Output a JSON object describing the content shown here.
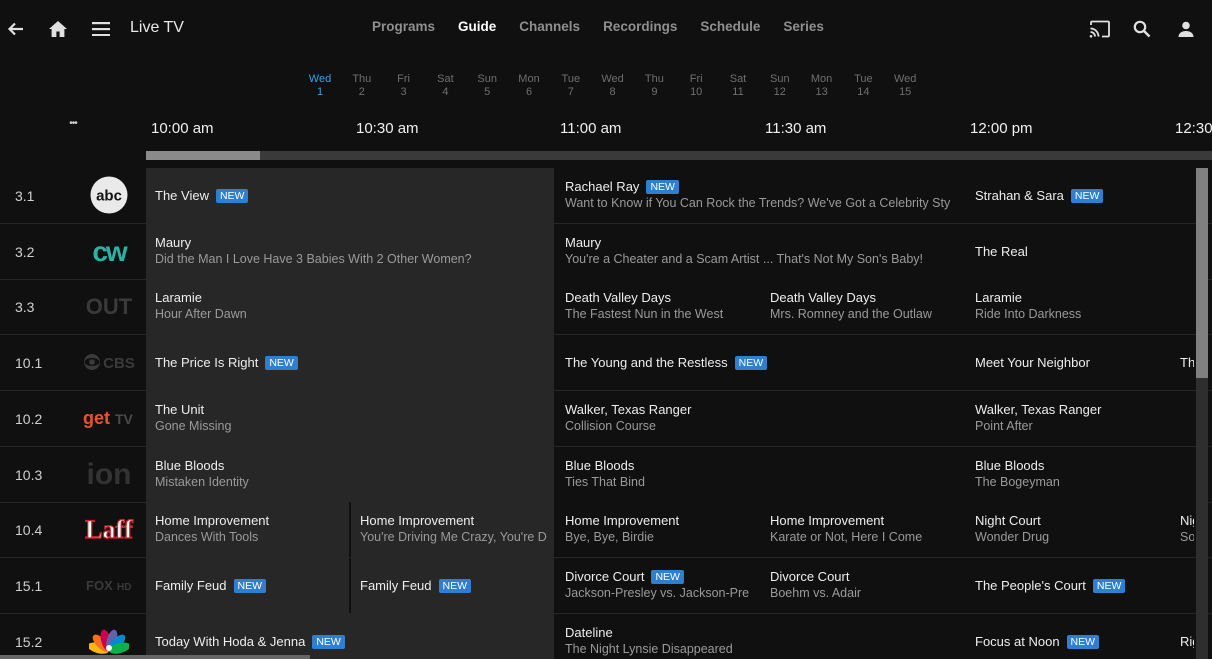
{
  "header": {
    "title": "Live TV",
    "icons": [
      "back-arrow-icon",
      "home-icon",
      "menu-icon",
      "cast-icon",
      "search-icon",
      "user-icon"
    ],
    "tabs": [
      {
        "label": "Programs",
        "active": false
      },
      {
        "label": "Guide",
        "active": true
      },
      {
        "label": "Channels",
        "active": false
      },
      {
        "label": "Recordings",
        "active": false
      },
      {
        "label": "Schedule",
        "active": false
      },
      {
        "label": "Series",
        "active": false
      }
    ]
  },
  "dates": [
    {
      "day": "Wed",
      "num": "1",
      "active": true
    },
    {
      "day": "Thu",
      "num": "2"
    },
    {
      "day": "Fri",
      "num": "3"
    },
    {
      "day": "Sat",
      "num": "4"
    },
    {
      "day": "Sun",
      "num": "5"
    },
    {
      "day": "Mon",
      "num": "6"
    },
    {
      "day": "Tue",
      "num": "7"
    },
    {
      "day": "Wed",
      "num": "8"
    },
    {
      "day": "Thu",
      "num": "9"
    },
    {
      "day": "Fri",
      "num": "10"
    },
    {
      "day": "Sat",
      "num": "11"
    },
    {
      "day": "Sun",
      "num": "12"
    },
    {
      "day": "Mon",
      "num": "13"
    },
    {
      "day": "Tue",
      "num": "14"
    },
    {
      "day": "Wed",
      "num": "15"
    }
  ],
  "more_label": "•••",
  "times": [
    "10:00 am",
    "10:30 am",
    "11:00 am",
    "11:30 am",
    "12:00 pm",
    "12:30 pm"
  ],
  "badge_label": "NEW",
  "channels": [
    {
      "num": "3.1",
      "logo": "abc",
      "programs": [
        {
          "title": "The View",
          "new": true,
          "start": 0,
          "end": 2
        },
        {
          "title": "Rachael Ray",
          "sub": "Want to Know if You Can Rock the Trends? We've Got a Celebrity Sty",
          "new": true,
          "start": 2,
          "end": 4
        },
        {
          "title": "Strahan & Sara",
          "new": true,
          "start": 4,
          "end": 6
        }
      ]
    },
    {
      "num": "3.2",
      "logo": "cw",
      "programs": [
        {
          "title": "Maury",
          "sub": "Did the Man I Love Have 3 Babies With 2 Other Women?",
          "start": 0,
          "end": 2
        },
        {
          "title": "Maury",
          "sub": "You're a Cheater and a Scam Artist ... That's Not My Son's Baby!",
          "start": 2,
          "end": 4
        },
        {
          "title": "The Real",
          "start": 4,
          "end": 6
        }
      ]
    },
    {
      "num": "3.3",
      "logo": "out",
      "programs": [
        {
          "title": "Laramie",
          "sub": "Hour After Dawn",
          "start": 0,
          "end": 2
        },
        {
          "title": "Death Valley Days",
          "sub": "The Fastest Nun in the West",
          "start": 2,
          "end": 3
        },
        {
          "title": "Death Valley Days",
          "sub": "Mrs. Romney and the Outlaw",
          "start": 3,
          "end": 4
        },
        {
          "title": "Laramie",
          "sub": "Ride Into Darkness",
          "start": 4,
          "end": 6
        }
      ]
    },
    {
      "num": "10.1",
      "logo": "cbs",
      "programs": [
        {
          "title": "The Price Is Right",
          "new": true,
          "start": 0,
          "end": 2
        },
        {
          "title": "The Young and the Restless",
          "new": true,
          "start": 2,
          "end": 4
        },
        {
          "title": "Meet Your Neighbor",
          "start": 4,
          "end": 5
        },
        {
          "title": "Th",
          "start": 5,
          "end": 6
        }
      ]
    },
    {
      "num": "10.2",
      "logo": "gettv",
      "programs": [
        {
          "title": "The Unit",
          "sub": "Gone Missing",
          "start": 0,
          "end": 2
        },
        {
          "title": "Walker, Texas Ranger",
          "sub": "Collision Course",
          "start": 2,
          "end": 4
        },
        {
          "title": "Walker, Texas Ranger",
          "sub": "Point After",
          "start": 4,
          "end": 6
        }
      ]
    },
    {
      "num": "10.3",
      "logo": "ion",
      "programs": [
        {
          "title": "Blue Bloods",
          "sub": "Mistaken Identity",
          "start": 0,
          "end": 2
        },
        {
          "title": "Blue Bloods",
          "sub": "Ties That Bind",
          "start": 2,
          "end": 4
        },
        {
          "title": "Blue Bloods",
          "sub": "The Bogeyman",
          "start": 4,
          "end": 6
        }
      ]
    },
    {
      "num": "10.4",
      "logo": "laff",
      "programs": [
        {
          "title": "Home Improvement",
          "sub": "Dances With Tools",
          "start": 0,
          "end": 1
        },
        {
          "title": "Home Improvement",
          "sub": "You're Driving Me Crazy, You're D",
          "start": 1,
          "end": 2
        },
        {
          "title": "Home Improvement",
          "sub": "Bye, Bye, Birdie",
          "start": 2,
          "end": 3
        },
        {
          "title": "Home Improvement",
          "sub": "Karate or Not, Here I Come",
          "start": 3,
          "end": 4
        },
        {
          "title": "Night Court",
          "sub": "Wonder Drug",
          "start": 4,
          "end": 5
        },
        {
          "title": "Nig",
          "sub": "So",
          "start": 5,
          "end": 6
        }
      ]
    },
    {
      "num": "15.1",
      "logo": "fox",
      "programs": [
        {
          "title": "Family Feud",
          "new": true,
          "start": 0,
          "end": 1
        },
        {
          "title": "Family Feud",
          "new": true,
          "start": 1,
          "end": 2
        },
        {
          "title": "Divorce Court",
          "sub": "Jackson-Presley vs. Jackson-Pre",
          "new": true,
          "start": 2,
          "end": 3
        },
        {
          "title": "Divorce Court",
          "sub": "Boehm vs. Adair",
          "start": 3,
          "end": 4
        },
        {
          "title": "The People's Court",
          "new": true,
          "start": 4,
          "end": 6
        }
      ]
    },
    {
      "num": "15.2",
      "logo": "nbc",
      "programs": [
        {
          "title": "Today With Hoda & Jenna",
          "new": true,
          "start": 0,
          "end": 2
        },
        {
          "title": "Dateline",
          "sub": "The Night Lynsie Disappeared",
          "start": 2,
          "end": 4
        },
        {
          "title": "Focus at Noon",
          "new": true,
          "start": 4,
          "end": 5
        },
        {
          "title": "Rig",
          "start": 5,
          "end": 6
        }
      ]
    }
  ],
  "colors": {
    "accent": "#3aa0e8",
    "badge": "#2f7fd0",
    "background": "#101010",
    "past_cell": "#272727"
  }
}
